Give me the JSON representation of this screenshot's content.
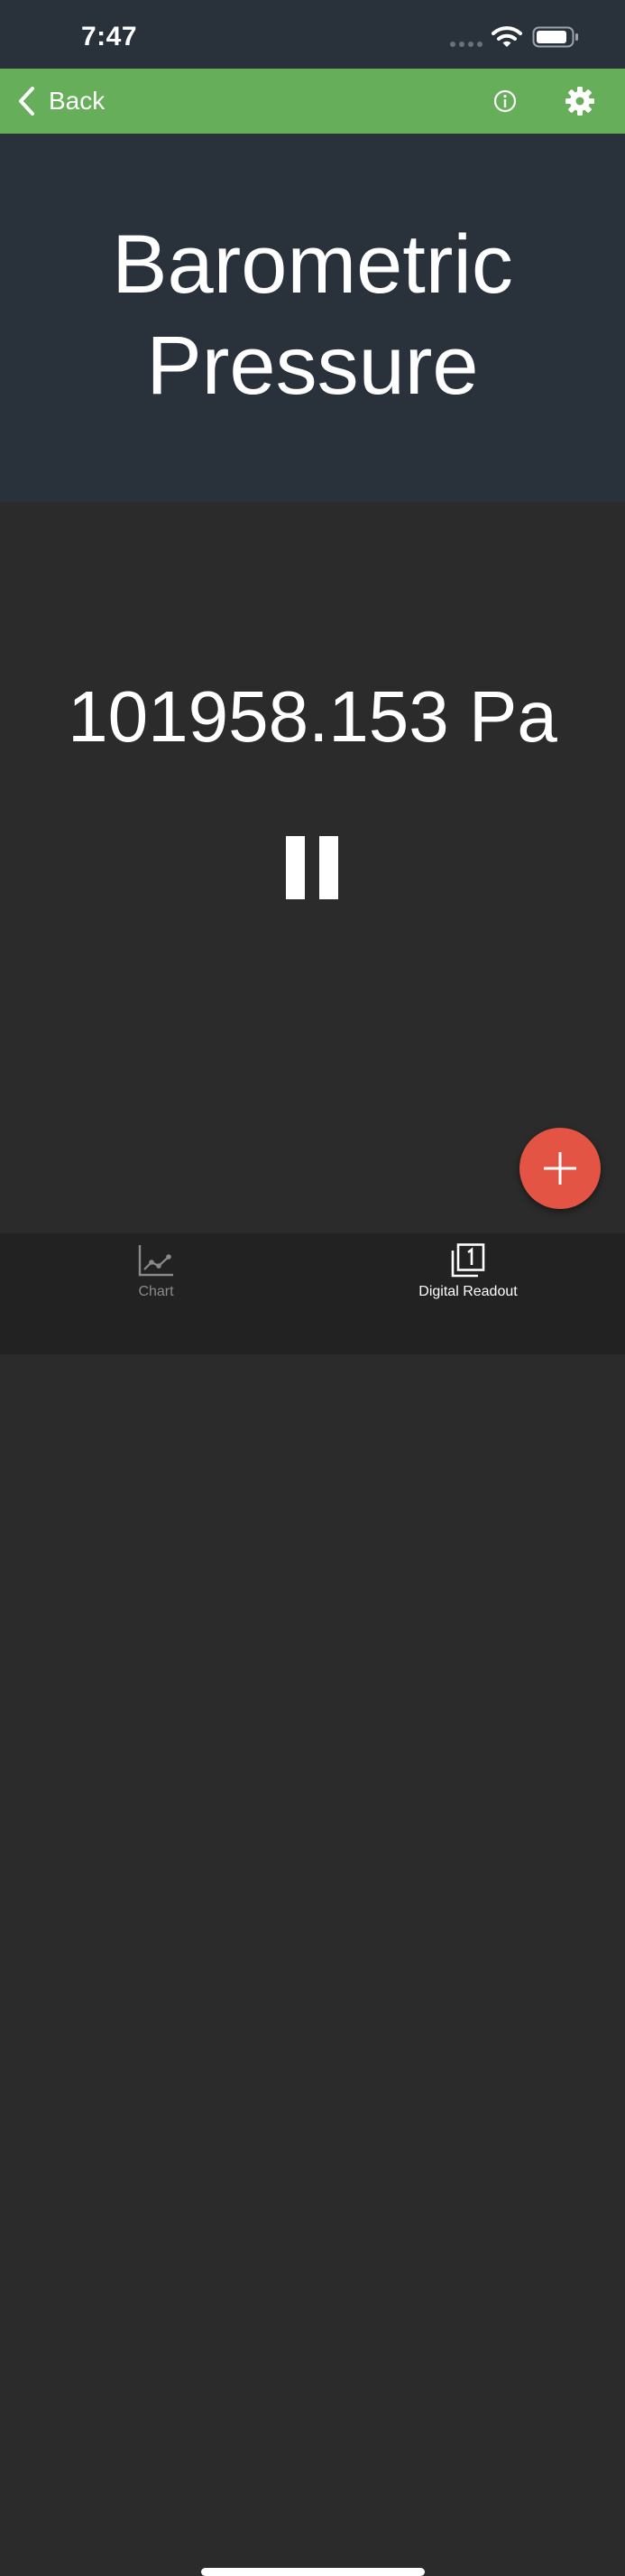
{
  "status_bar": {
    "time": "7:47",
    "icons": [
      "cellular-signal-icon",
      "wifi-icon",
      "battery-icon"
    ]
  },
  "nav": {
    "back_label": "Back",
    "back_icon": "chevron-left-icon",
    "info_icon": "info-icon",
    "settings_icon": "gear-icon",
    "background_color": "#67ae5b"
  },
  "sensor": {
    "title": "Barometric Pressure"
  },
  "readout": {
    "value": "101958.153 Pa",
    "pause_icon": "pause-icon"
  },
  "fab": {
    "icon": "plus-icon",
    "color": "#e35444"
  },
  "tabs": [
    {
      "label": "Chart",
      "icon": "line-chart-icon",
      "active": false
    },
    {
      "label": "Digital Readout",
      "icon": "digital-readout-icon",
      "active": true
    }
  ]
}
